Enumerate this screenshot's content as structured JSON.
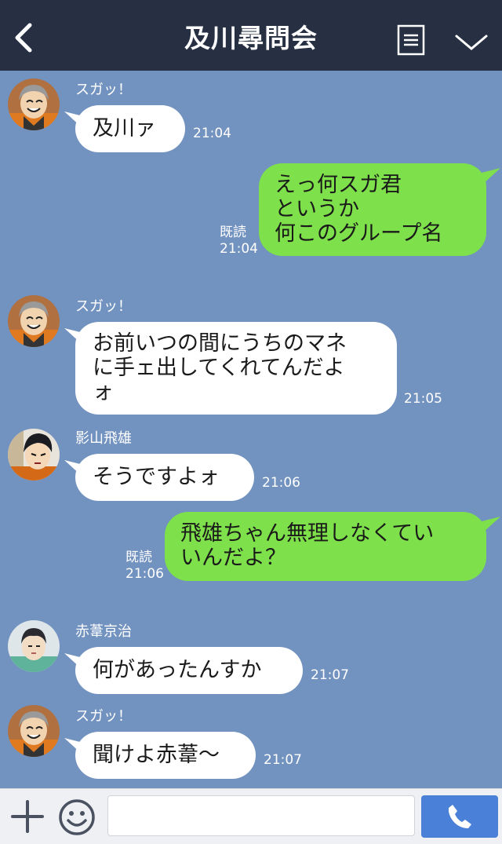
{
  "header": {
    "title": "及川尋問会"
  },
  "messages": [
    {
      "sender": "スガッ！",
      "lines": [
        "及川ァ"
      ],
      "time": "21:04"
    },
    {
      "lines": [
        "えっ何スガ君",
        "というか",
        "何このグループ名"
      ],
      "read": "既読",
      "time": "21:04"
    },
    {
      "sender": "スガッ！",
      "lines": [
        "お前いつの間にうちのマネ",
        "に手ェ出してくれてんだよ",
        "ォ"
      ],
      "time": "21:05"
    },
    {
      "sender": "影山飛雄",
      "lines": [
        "そうですよォ"
      ],
      "time": "21:06"
    },
    {
      "lines": [
        "飛雄ちゃん無理しなくてい",
        "いんだよ？"
      ],
      "read": "既読",
      "time": "21:06"
    },
    {
      "sender": "赤葦京治",
      "lines": [
        "何があったんすか"
      ],
      "time": "21:07"
    },
    {
      "sender": "スガッ！",
      "lines": [
        "聞けよ赤葦〜"
      ],
      "time": "21:07"
    }
  ],
  "colors": {
    "header_bg": "#263042",
    "chat_bg": "#7292c0",
    "incoming_bubble": "#ffffff",
    "outgoing_bubble": "#7ee04a",
    "send_button": "#4a80d8"
  },
  "icons": {
    "back": "chevron-left-icon",
    "menu": "menu-icon",
    "collapse": "chevron-down-icon",
    "add": "plus-icon",
    "emoji": "emoji-icon",
    "call": "phone-icon"
  }
}
